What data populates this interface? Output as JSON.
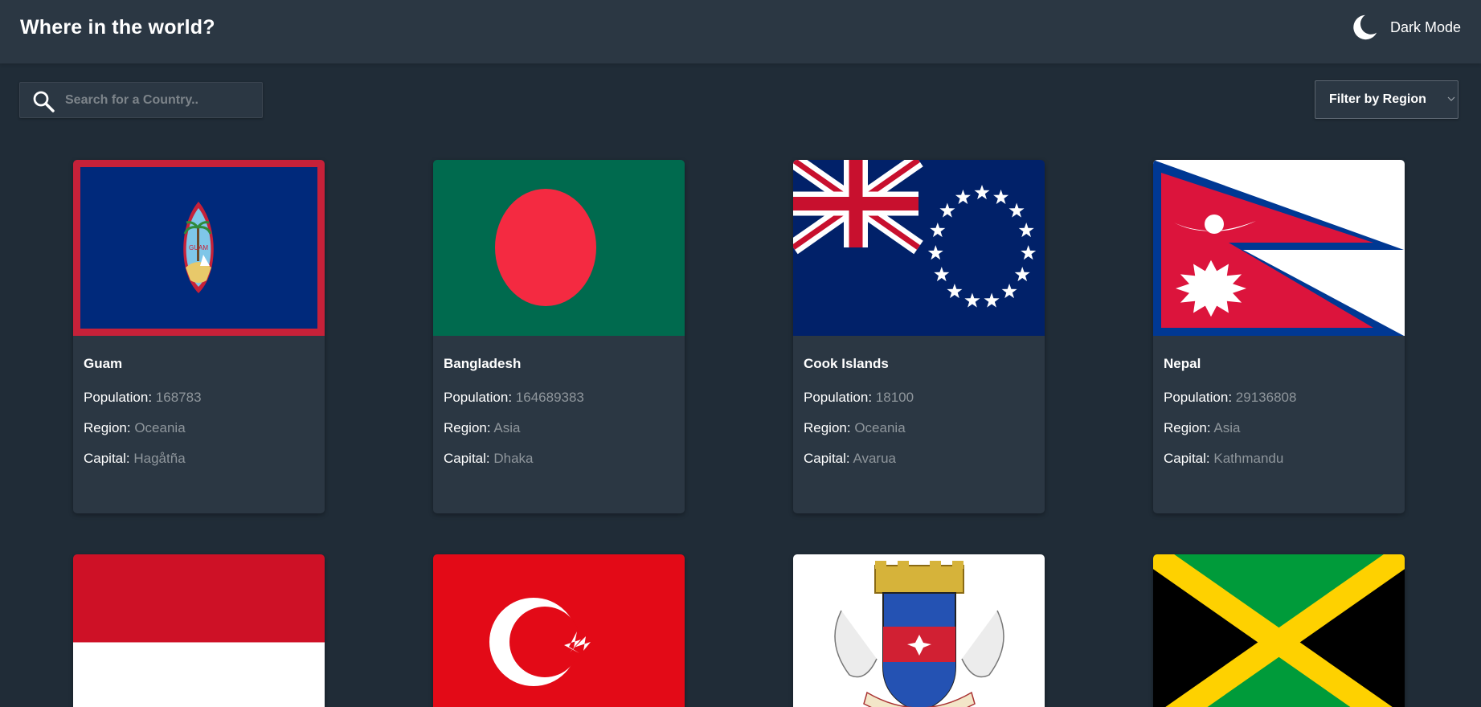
{
  "header": {
    "title": "Where in the world?",
    "mode_icon": "moon-icon",
    "mode_label": "Dark Mode"
  },
  "search": {
    "icon": "search-icon",
    "placeholder": "Search for a Country..",
    "value": ""
  },
  "filter": {
    "label": "Filter by Region",
    "icon": "chevron-down-icon"
  },
  "labels": {
    "population": "Population: ",
    "region": "Region: ",
    "capital": "Capital: "
  },
  "countries": [
    {
      "name": "Guam",
      "population": "168783",
      "region": "Oceania",
      "capital": "Hagåtña",
      "flag_icon": "guam-flag"
    },
    {
      "name": "Bangladesh",
      "population": "164689383",
      "region": "Asia",
      "capital": "Dhaka",
      "flag_icon": "bangladesh-flag"
    },
    {
      "name": "Cook Islands",
      "population": "18100",
      "region": "Oceania",
      "capital": "Avarua",
      "flag_icon": "cook-islands-flag"
    },
    {
      "name": "Nepal",
      "population": "29136808",
      "region": "Asia",
      "capital": "Kathmandu",
      "flag_icon": "nepal-flag"
    },
    {
      "flag_icon": "indonesia-flag"
    },
    {
      "flag_icon": "turkey-flag"
    },
    {
      "flag_icon": "saint-barthelemy-flag"
    },
    {
      "flag_icon": "jamaica-flag"
    }
  ],
  "colors": {
    "background": "#202c37",
    "surface": "#2b3743",
    "text": "#ffffff",
    "muted": "#8f969c"
  }
}
